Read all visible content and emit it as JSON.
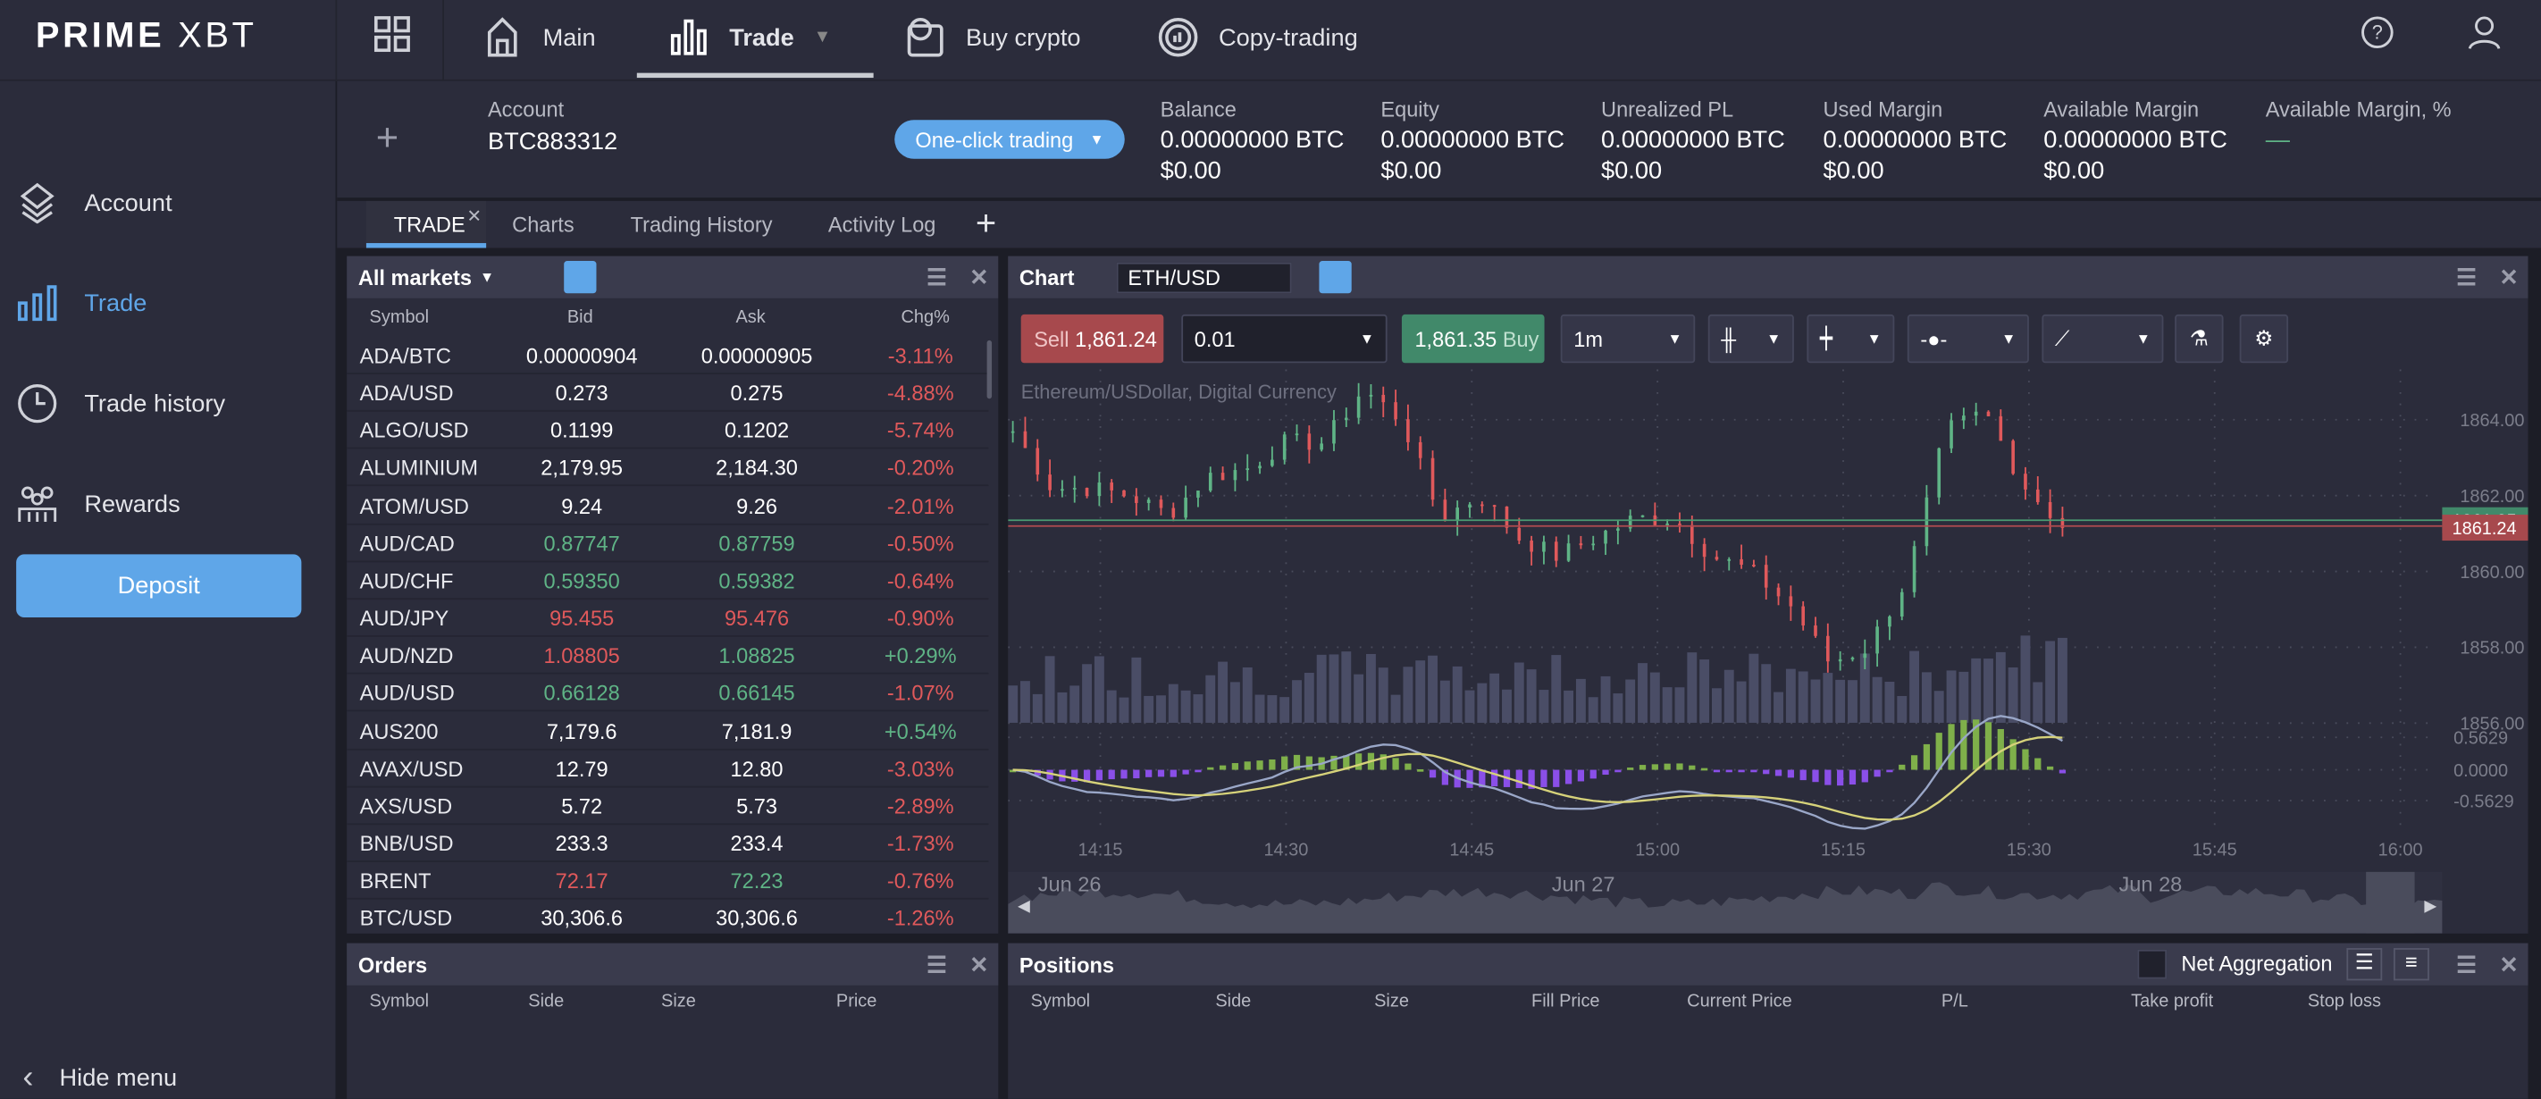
{
  "topbar": {
    "logo": "PRIME XBT",
    "nav": [
      {
        "label": "Main",
        "icon": "home-icon"
      },
      {
        "label": "Trade",
        "icon": "bar-chart-icon",
        "active": true
      },
      {
        "label": "Buy crypto",
        "icon": "wallet-bitcoin-icon"
      },
      {
        "label": "Copy-trading",
        "icon": "copy-trading-icon"
      }
    ]
  },
  "sidebar": {
    "items": [
      {
        "label": "Account",
        "icon": "layers-icon"
      },
      {
        "label": "Trade",
        "icon": "bar-chart-icon",
        "active": true
      },
      {
        "label": "Trade history",
        "icon": "clock-icon"
      },
      {
        "label": "Rewards",
        "icon": "people-icon"
      }
    ],
    "deposit": "Deposit",
    "hide_menu": "Hide menu"
  },
  "account": {
    "label": "Account",
    "id": "BTC883312",
    "one_click": "One-click trading",
    "stats": [
      {
        "label": "Balance",
        "btc": "0.00000000 BTC",
        "usd": "$0.00"
      },
      {
        "label": "Equity",
        "btc": "0.00000000 BTC",
        "usd": "$0.00"
      },
      {
        "label": "Unrealized PL",
        "btc": "0.00000000 BTC",
        "usd": "$0.00"
      },
      {
        "label": "Used Margin",
        "btc": "0.00000000 BTC",
        "usd": "$0.00"
      },
      {
        "label": "Available Margin",
        "btc": "0.00000000 BTC",
        "usd": "$0.00"
      },
      {
        "label": "Available Margin, %",
        "btc": "—",
        "usd": ""
      }
    ]
  },
  "tabs": [
    "TRADE",
    "Charts",
    "Trading History",
    "Activity Log"
  ],
  "markets": {
    "title": "All markets",
    "columns": [
      "Symbol",
      "Bid",
      "Ask",
      "Chg%"
    ],
    "rows": [
      [
        "ADA/BTC",
        "0.00000904",
        "0.00000905",
        "-3.11%",
        "white",
        "white"
      ],
      [
        "ADA/USD",
        "0.273",
        "0.275",
        "-4.88%",
        "white",
        "white"
      ],
      [
        "ALGO/USD",
        "0.1199",
        "0.1202",
        "-5.74%",
        "white",
        "white"
      ],
      [
        "ALUMINIUM",
        "2,179.95",
        "2,184.30",
        "-0.20%",
        "white",
        "white"
      ],
      [
        "ATOM/USD",
        "9.24",
        "9.26",
        "-2.01%",
        "white",
        "white"
      ],
      [
        "AUD/CAD",
        "0.87747",
        "0.87759",
        "-0.50%",
        "green",
        "green"
      ],
      [
        "AUD/CHF",
        "0.59350",
        "0.59382",
        "-0.64%",
        "green",
        "green"
      ],
      [
        "AUD/JPY",
        "95.455",
        "95.476",
        "-0.90%",
        "red",
        "red"
      ],
      [
        "AUD/NZD",
        "1.08805",
        "1.08825",
        "+0.29%",
        "red",
        "green"
      ],
      [
        "AUD/USD",
        "0.66128",
        "0.66145",
        "-1.07%",
        "green",
        "green"
      ],
      [
        "AUS200",
        "7,179.6",
        "7,181.9",
        "+0.54%",
        "white",
        "white"
      ],
      [
        "AVAX/USD",
        "12.79",
        "12.80",
        "-3.03%",
        "white",
        "white"
      ],
      [
        "AXS/USD",
        "5.72",
        "5.73",
        "-2.89%",
        "white",
        "white"
      ],
      [
        "BNB/USD",
        "233.3",
        "233.4",
        "-1.73%",
        "white",
        "white"
      ],
      [
        "BRENT",
        "72.17",
        "72.23",
        "-0.76%",
        "red",
        "green"
      ],
      [
        "BTC/USD",
        "30,306.6",
        "30,306.6",
        "-1.26%",
        "white",
        "white"
      ]
    ]
  },
  "chart": {
    "title": "Chart",
    "symbol": "ETH/USD",
    "sell_label": "Sell",
    "sell_price": "1,861.24",
    "quantity": "0.01",
    "buy_price": "1,861.35",
    "buy_label": "Buy",
    "interval": "1m",
    "description": "Ethereum/USDollar, Digital Currency",
    "price_ticks": [
      "1864.00",
      "1862.00",
      "1860.00",
      "1858.00",
      "1856.00"
    ],
    "ask_tag": "1861.35",
    "bid_tag": "1861.24",
    "macd_ticks": [
      "0.5629",
      "0.0000",
      "-0.5629"
    ],
    "time_ticks": [
      "14:15",
      "14:30",
      "14:45",
      "15:00",
      "15:15",
      "15:30",
      "15:45",
      "16:00"
    ],
    "nav_dates": [
      "Jun 26",
      "Jun 27",
      "Jun 28"
    ]
  },
  "chart_data": {
    "type": "candlestick",
    "price_keypoints": [
      1863.7,
      1862.2,
      1862.2,
      1862.0,
      1861.5,
      1862.5,
      1862.7,
      1863.4,
      1863.4,
      1864.8,
      1864.0,
      1861.4,
      1862.0,
      1860.9,
      1860.4,
      1860.9,
      1861.4,
      1861.4,
      1860.4,
      1860.0,
      1859.1,
      1857.6,
      1858.0,
      1859.8,
      1863.7,
      1864.2,
      1862.3,
      1861.2
    ],
    "ylim": [
      1856,
      1864.8
    ],
    "colors": {
      "up": "#5fb486",
      "down": "#e0595b"
    }
  },
  "orders": {
    "title": "Orders",
    "columns": [
      "Symbol",
      "Side",
      "Size",
      "Price"
    ]
  },
  "positions": {
    "title": "Positions",
    "net_aggregation": "Net Aggregation",
    "columns": [
      "Symbol",
      "Side",
      "Size",
      "Fill Price",
      "Current Price",
      "P/L",
      "Take profit",
      "Stop loss"
    ]
  }
}
